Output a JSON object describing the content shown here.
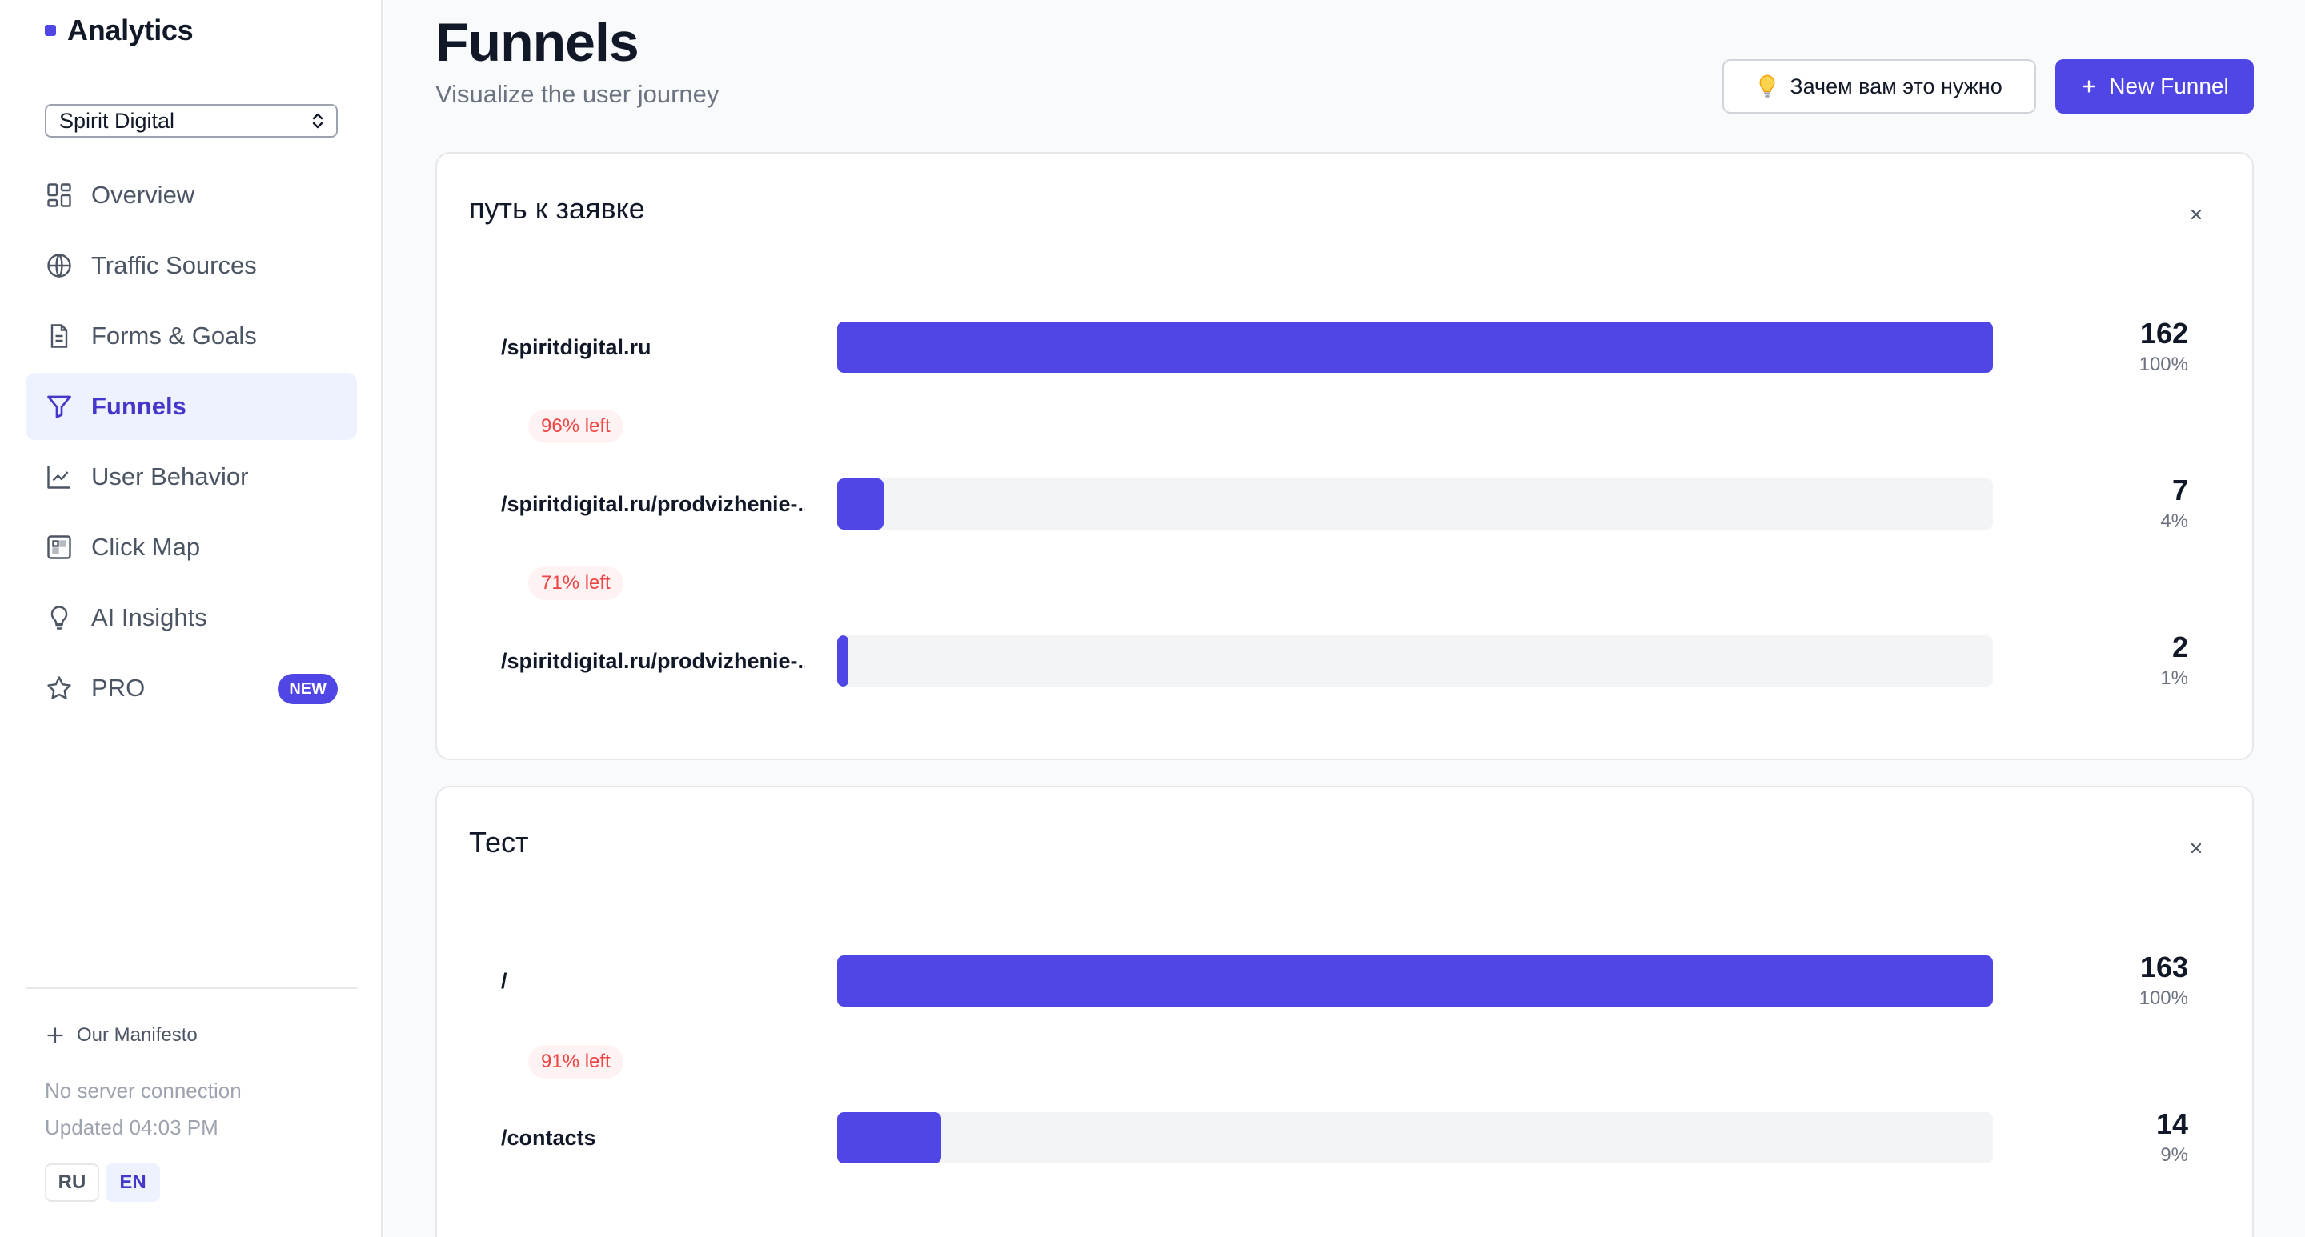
{
  "sidebar": {
    "brand": "Analytics",
    "project": "Spirit Digital",
    "items": [
      {
        "label": "Overview",
        "icon": "grid-icon",
        "active": false
      },
      {
        "label": "Traffic Sources",
        "icon": "globe-icon",
        "active": false
      },
      {
        "label": "Forms & Goals",
        "icon": "document-icon",
        "active": false
      },
      {
        "label": "Funnels",
        "icon": "funnel-icon",
        "active": true
      },
      {
        "label": "User Behavior",
        "icon": "line-chart-icon",
        "active": false
      },
      {
        "label": "Click Map",
        "icon": "click-map-icon",
        "active": false
      },
      {
        "label": "AI Insights",
        "icon": "lightbulb-icon",
        "active": false
      },
      {
        "label": "PRO",
        "icon": "star-icon",
        "active": false,
        "badge": "NEW"
      }
    ],
    "manifesto": "Our Manifesto",
    "connection_status": "No server connection",
    "updated": "Updated 04:03 PM",
    "languages": [
      {
        "label": "RU",
        "active": false
      },
      {
        "label": "EN",
        "active": true
      }
    ]
  },
  "header": {
    "title": "Funnels",
    "subtitle": "Visualize the user journey",
    "why_button": "Зачем вам это нужно",
    "new_button": "New Funnel"
  },
  "funnels": [
    {
      "name": "путь к заявке",
      "steps": [
        {
          "label": "/spiritdigital.ru",
          "count": "162",
          "percent": "100%",
          "fill": 1.0
        },
        {
          "label": "/spiritdigital.ru/prodvizhenie-...",
          "count": "7",
          "percent": "4%",
          "fill": 0.04
        },
        {
          "label": "/spiritdigital.ru/prodvizhenie-...",
          "count": "2",
          "percent": "1%",
          "fill": 0.01
        }
      ],
      "dropoffs": [
        "96% left",
        "71% left"
      ]
    },
    {
      "name": "Тест",
      "steps": [
        {
          "label": "/",
          "count": "163",
          "percent": "100%",
          "fill": 1.0
        },
        {
          "label": "/contacts",
          "count": "14",
          "percent": "9%",
          "fill": 0.09
        }
      ],
      "dropoffs": [
        "91% left"
      ]
    }
  ],
  "colors": {
    "accent": "#4f46e5",
    "accent_bg": "#eef2ff",
    "dropoff_text": "#ef4444",
    "dropoff_bg": "#fef2f2",
    "track": "#f3f4f6"
  }
}
